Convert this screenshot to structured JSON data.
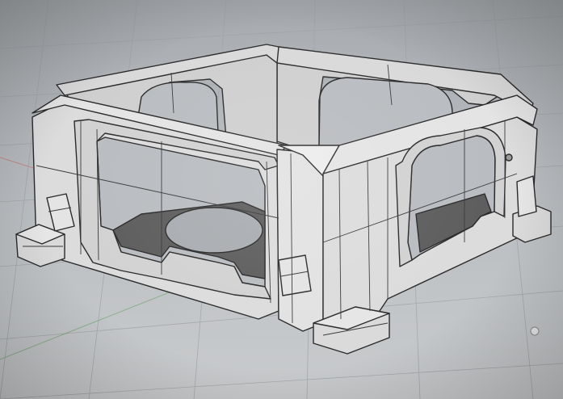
{
  "viewport": {
    "kind": "3d-perspective-viewport",
    "background_color": "#b4b7bb",
    "grid_color": "#9ea2a6",
    "x_axis_color": "#c06a6a",
    "y_axis_color": "#6aa06a"
  },
  "model": {
    "face_color": "#dcdcdc",
    "inner_color": "#cfcfcf",
    "floor_color": "#5d5d5d",
    "edge_color": "#2a2a2a"
  },
  "icons": {
    "light": "light-bulb-icon"
  }
}
